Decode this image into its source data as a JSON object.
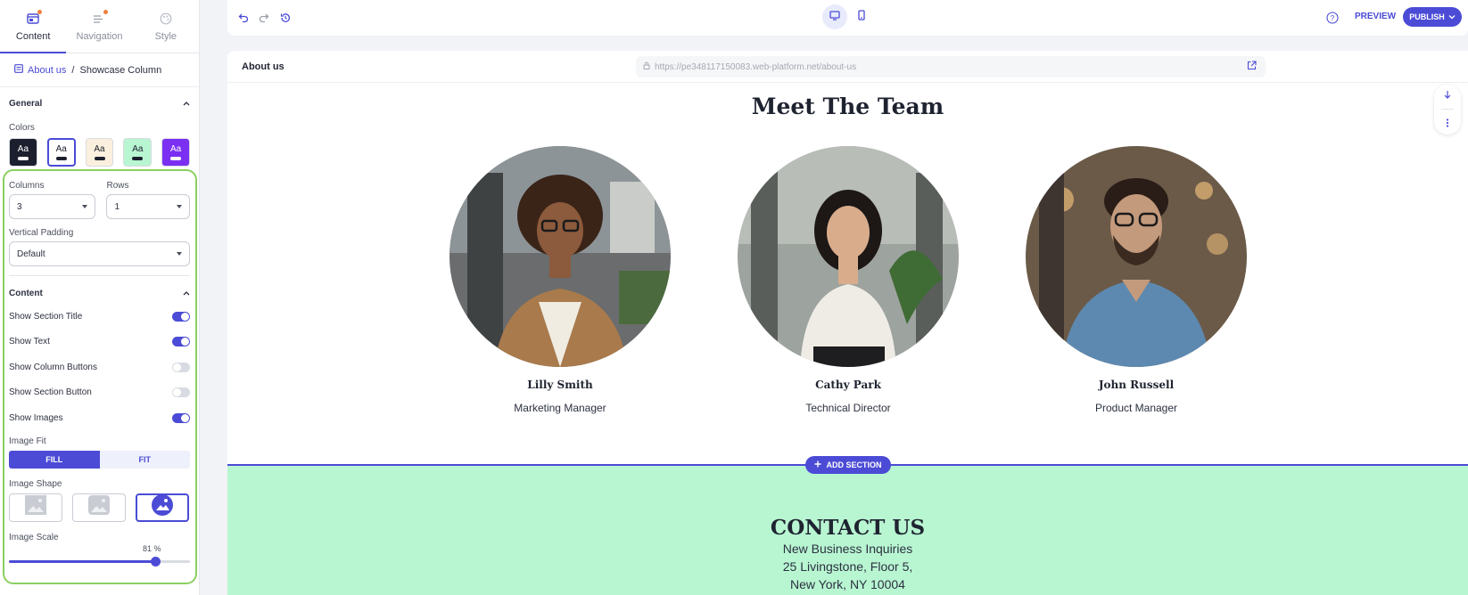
{
  "sidebar": {
    "tabs": [
      {
        "label": "Content",
        "icon": "layout-icon",
        "active": true
      },
      {
        "label": "Navigation",
        "icon": "menu-list-icon",
        "active": false
      },
      {
        "label": "Style",
        "icon": "palette-icon",
        "active": false
      }
    ],
    "breadcrumb": {
      "parent": "About us",
      "separator": "/",
      "current": "Showcase Column"
    },
    "general": {
      "title": "General",
      "colors_label": "Colors",
      "swatches": [
        {
          "text": "Aa",
          "bg": "#1c1f2e",
          "fg": "#ffffff",
          "bar": "#ffffff",
          "selected": false
        },
        {
          "text": "Aa",
          "bg": "#ffffff",
          "fg": "#1c1f2e",
          "bar": "#1c1f2e",
          "selected": true
        },
        {
          "text": "Aa",
          "bg": "#fbf0de",
          "fg": "#1c1f2e",
          "bar": "#1c1f2e",
          "selected": false
        },
        {
          "text": "Aa",
          "bg": "#b8f6d2",
          "fg": "#1c1f2e",
          "bar": "#1c1f2e",
          "selected": false
        },
        {
          "text": "Aa",
          "bg": "#7b2ff2",
          "fg": "#ffffff",
          "bar": "#ffffff",
          "selected": false
        }
      ],
      "columns_label": "Columns",
      "columns_value": "3",
      "rows_label": "Rows",
      "rows_value": "1",
      "vpadding_label": "Vertical Padding",
      "vpadding_value": "Default"
    },
    "content": {
      "title": "Content",
      "toggles": [
        {
          "label": "Show Section Title",
          "on": true
        },
        {
          "label": "Show Text",
          "on": true
        },
        {
          "label": "Show Column Buttons",
          "on": false
        },
        {
          "label": "Show Section Button",
          "on": false
        },
        {
          "label": "Show Images",
          "on": true
        }
      ],
      "image_fit_label": "Image Fit",
      "image_fit_options": [
        "FILL",
        "FIT"
      ],
      "image_fit_selected": "FILL",
      "image_shape_label": "Image Shape",
      "image_shape_selected": "circle",
      "image_scale_label": "Image Scale",
      "image_scale_value": "81 %",
      "image_scale_fraction": 0.81
    }
  },
  "toolbar": {
    "preview_label": "PREVIEW",
    "publish_label": "PUBLISH",
    "accent": "#4b4bd6"
  },
  "canvas": {
    "page_name": "About us",
    "url": "https://pe348117150083.web-platform.net/about-us",
    "team_title": "Meet The Team",
    "members": [
      {
        "name": "Lilly Smith",
        "role": "Marketing Manager"
      },
      {
        "name": "Cathy Park",
        "role": "Technical Director"
      },
      {
        "name": "John Russell",
        "role": "Product Manager"
      }
    ],
    "add_section_label": "ADD SECTION",
    "contact": {
      "title": "CONTACT US",
      "lines": [
        "New Business Inquiries",
        "25 Livingstone, Floor 5,",
        "New York, NY 10004"
      ]
    }
  }
}
